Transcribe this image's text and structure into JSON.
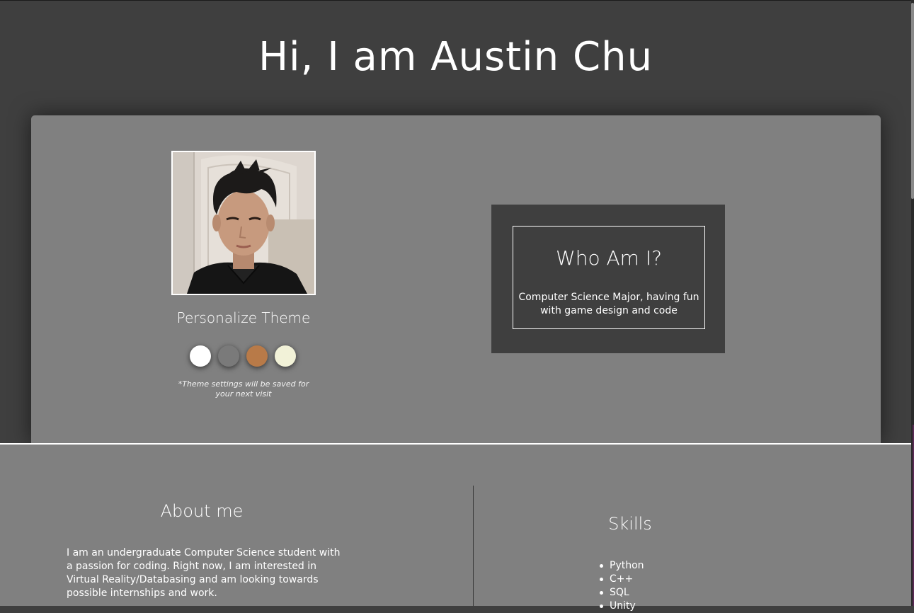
{
  "header": {
    "title": "Hi, I am Austin Chu"
  },
  "profile": {
    "photo_alt": "Austin Chu",
    "theme_title": "Personalize Theme",
    "theme_swatches": [
      {
        "name": "white",
        "color": "#ffffff"
      },
      {
        "name": "gray",
        "color": "#7a7a7a"
      },
      {
        "name": "copper",
        "color": "#b87a48"
      },
      {
        "name": "cream",
        "color": "#f2f2d8"
      }
    ],
    "save_note": "*Theme settings will be saved for your next visit"
  },
  "who": {
    "title": "Who Am I?",
    "text": "Computer Science Major, having fun with game design and code"
  },
  "about": {
    "title": "About me",
    "text": "I am an undergraduate Computer Science student with a passion for coding. Right now, I am interested in Virtual Reality/Databasing and am looking towards possible internships and work."
  },
  "skills": {
    "title": "Skills",
    "items": [
      "Python",
      "C++",
      "SQL",
      "Unity"
    ]
  },
  "colors": {
    "page_background": "#3f3f3f",
    "card_background": "#808080",
    "text": "#ffffff"
  }
}
